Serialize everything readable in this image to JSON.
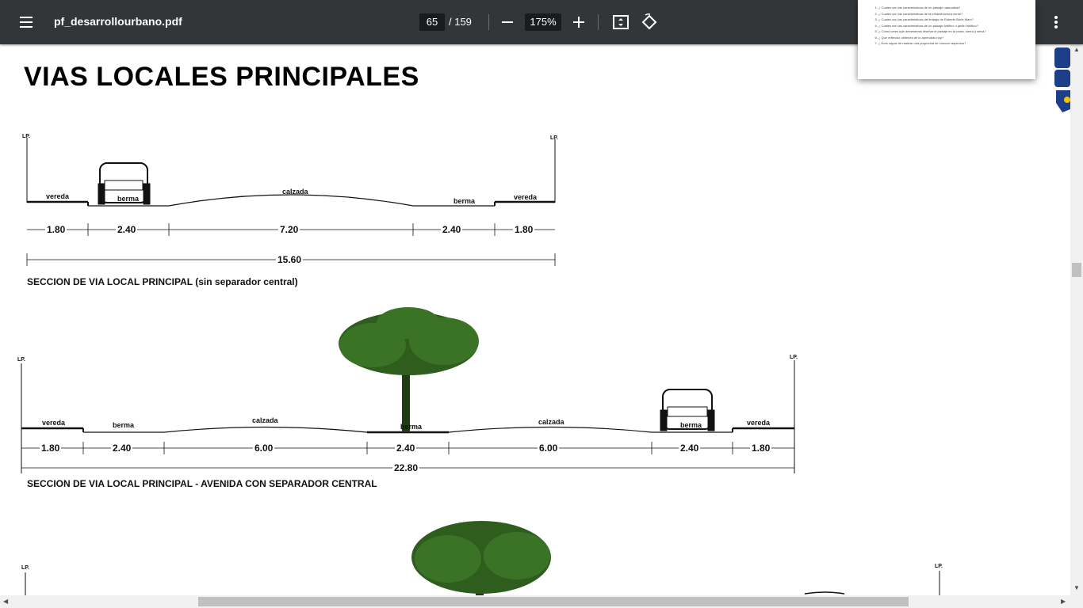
{
  "toolbar": {
    "file_name": "pf_desarrollourbano.pdf",
    "current_page": "65",
    "page_total": "/ 159",
    "zoom_level": "175%"
  },
  "document": {
    "title": "VIAS LOCALES PRINCIPALES",
    "section1": {
      "lp_left": "LP.",
      "lp_right": "LP.",
      "labels": [
        "vereda",
        "berma",
        "calzada",
        "berma",
        "vereda"
      ],
      "dimensions": [
        "1.80",
        "2.40",
        "7.20",
        "2.40",
        "1.80"
      ],
      "total": "15.60",
      "caption": "SECCION DE VIA LOCAL PRINCIPAL (sin separador central)"
    },
    "section2": {
      "lp_left": "LP.",
      "lp_right": "LP.",
      "labels": [
        "vereda",
        "berma",
        "calzada",
        "berma",
        "calzada",
        "berma",
        "vereda"
      ],
      "dimensions": [
        "1.80",
        "2.40",
        "6.00",
        "2.40",
        "6.00",
        "2.40",
        "1.80"
      ],
      "total": "22.80",
      "caption": "SECCION DE VIA LOCAL PRINCIPAL  -  AVENIDA CON SEPARADOR CENTRAL"
    },
    "section3": {
      "lp_left": "LP.",
      "lp_right": "LP."
    }
  },
  "thumbnail_popup": {
    "items": [
      "¿ Cuales son las caracteristicas de un paisaje naturalista?",
      "¿ Cuales son las caracteristicas de la infraestructura verde?",
      "¿ Cuales son las caracteristicas del trabajo de Roberto Burle Marx?",
      "¿ Cuales son las caracteristicas de un paisaje fortifico o jardin fortifico?",
      "¿ Cómo crees que deberiamos diseñar el paisaje en la costa, sierra y selva?",
      "¿ Que reflexión obtienes de lo aprendido hoy?",
      "¿ Eres capaz de realizar una propuesta de conocer aspectos?"
    ]
  },
  "colors": {
    "toolbar_bg": "#323639",
    "tree_green": "#2e5d1e"
  },
  "icons": {
    "menu": "hamburger-icon",
    "zoom_out": "minus-icon",
    "zoom_in": "plus-icon",
    "fit": "fit-page-icon",
    "rotate": "rotate-icon",
    "more": "more-vert-icon"
  }
}
